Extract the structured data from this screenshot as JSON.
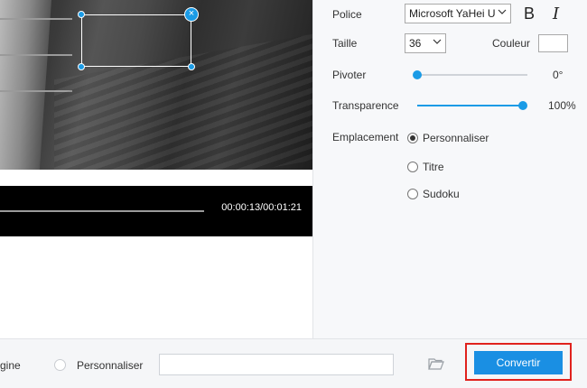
{
  "player": {
    "timecode": "00:00:13/00:01:21",
    "progress_fraction": 0.16
  },
  "watermark_panel": {
    "font_label": "Police",
    "font_value": "Microsoft YaHei U",
    "bold_label": "B",
    "italic_label": "I",
    "size_label": "Taille",
    "size_value": "36",
    "color_label": "Couleur",
    "color_value": "#ffffff",
    "rotate_label": "Pivoter",
    "rotate_value": "0°",
    "rotate_fraction": 0.0,
    "opacity_label": "Transparence",
    "opacity_value": "100%",
    "opacity_fraction": 1.0,
    "placement_label": "Emplacement",
    "placement_options": [
      "Personnaliser",
      "Titre",
      "Sudoku"
    ],
    "placement_selected": "Personnaliser"
  },
  "bottom_bar": {
    "partial_option_label": "gine",
    "custom_option_label": "Personnaliser",
    "path_value": "",
    "folder_icon": "folder-open-icon",
    "convert_label": "Convertir"
  },
  "colors": {
    "accent": "#1a8fe3",
    "highlight": "#e0221d",
    "player_bg": "#000000"
  }
}
